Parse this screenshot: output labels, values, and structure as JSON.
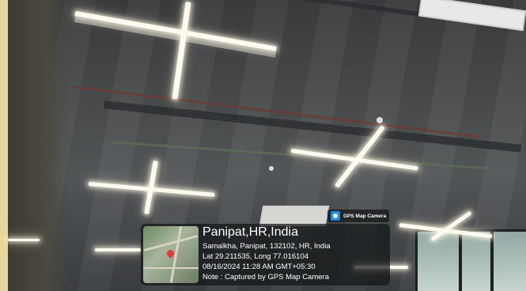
{
  "photo": {
    "scene": "office ceiling with cross-shaped linear LED lights",
    "app_badge": {
      "icon": "camera-icon",
      "name": "GPS Map Camera"
    },
    "overlay": {
      "title": "Panipat,HR,India",
      "address": "Samalkha, Panipat, 132102, HR, India",
      "coords": "Lat 29.211535, Long 77.016104",
      "datetime": "08/16/2024 11:28 AM GMT+05:30",
      "note": "Note : Captured by GPS Map Camera"
    }
  }
}
